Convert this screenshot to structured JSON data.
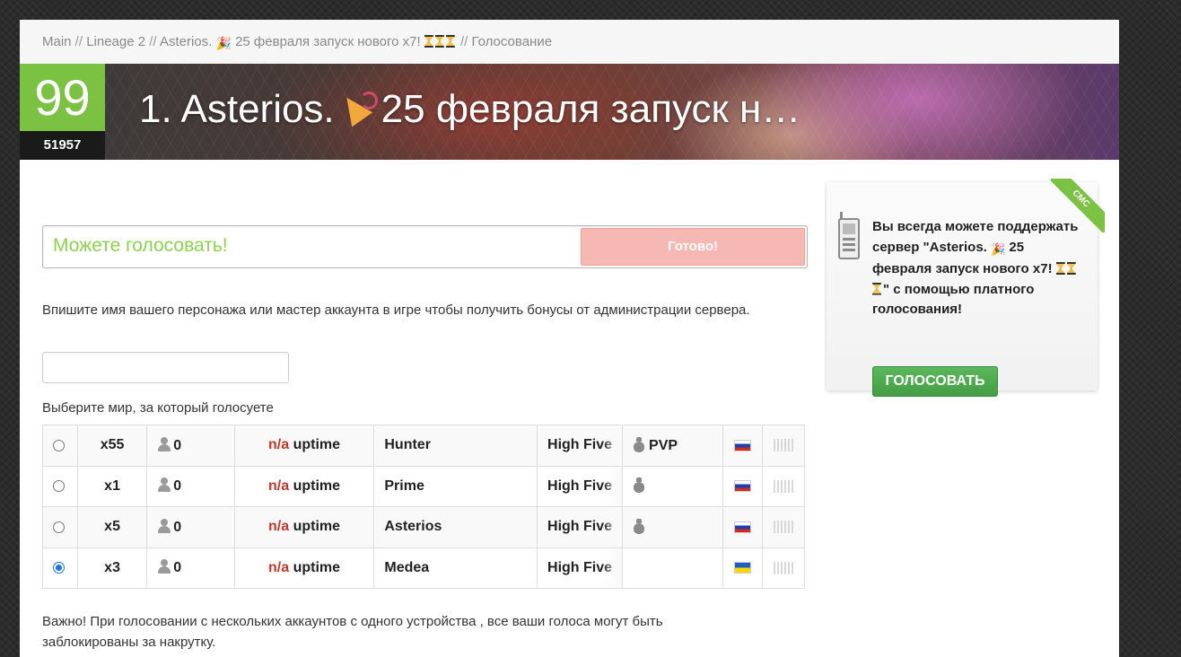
{
  "breadcrumb": {
    "main": "Main",
    "sep1": " // ",
    "game": "Lineage 2",
    "sep2": " // ",
    "server_prefix": "Asterios. ",
    "server_suffix": " 25 февраля запуск нового x7! ",
    "sep3": " // ",
    "current": "Голосование"
  },
  "banner": {
    "score": "99",
    "votes": "51957",
    "title_prefix": "1.   Asterios.",
    "title_suffix": "25 февраля запуск н…"
  },
  "vote_status": {
    "text": "Можете голосовать!",
    "button": "Готово!"
  },
  "form": {
    "hint": "Впишите имя вашего персонажа или мастер аккаунта в игре чтобы получить бонусы от администрации сервера.",
    "name_value": "",
    "world_label": "Выберите мир, за который голосуете"
  },
  "worlds": [
    {
      "selected": false,
      "rate": "x55",
      "online": "0",
      "uptime_status": "n/a",
      "uptime_label": "uptime",
      "name": "Hunter",
      "chronicle": "High Five",
      "has_bag": true,
      "type": "PVP",
      "flag": "ru"
    },
    {
      "selected": false,
      "rate": "x1",
      "online": "0",
      "uptime_status": "n/a",
      "uptime_label": "uptime",
      "name": "Prime",
      "chronicle": "High Five",
      "has_bag": true,
      "type": "",
      "flag": "ru"
    },
    {
      "selected": false,
      "rate": "x5",
      "online": "0",
      "uptime_status": "n/a",
      "uptime_label": "uptime",
      "name": "Asterios",
      "chronicle": "High Five",
      "has_bag": true,
      "type": "",
      "flag": "ru"
    },
    {
      "selected": true,
      "rate": "x3",
      "online": "0",
      "uptime_status": "n/a",
      "uptime_label": "uptime",
      "name": "Medea",
      "chronicle": "High Five",
      "has_bag": false,
      "type": "",
      "flag": "ua"
    }
  ],
  "warning": "Важно! При голосовании с нескольких аккаунтов с одного устройства , все ваши голоса могут быть заблокированы за накрутку.",
  "sms_card": {
    "ribbon": "СМС",
    "text_line1": "Вы всегда можете поддержать сервер \"Asterios. ",
    "text_line2": " 25 февраля запуск нового x7! ",
    "text_line3": "\" с помощью платного голосования!",
    "button": "ГОЛОСОВАТЬ"
  },
  "colors": {
    "score_bg": "#7bc142",
    "status_text": "#8cd34a",
    "done_button": "#f5b8b3",
    "vote_button": "#5cb85c",
    "na_text": "#c0392b"
  },
  "icons": [
    "party-popper-icon",
    "hourglass-icon",
    "person-icon",
    "money-bag-icon",
    "flag-ru-icon",
    "flag-ua-icon",
    "signal-bars-icon",
    "phone-icon"
  ]
}
